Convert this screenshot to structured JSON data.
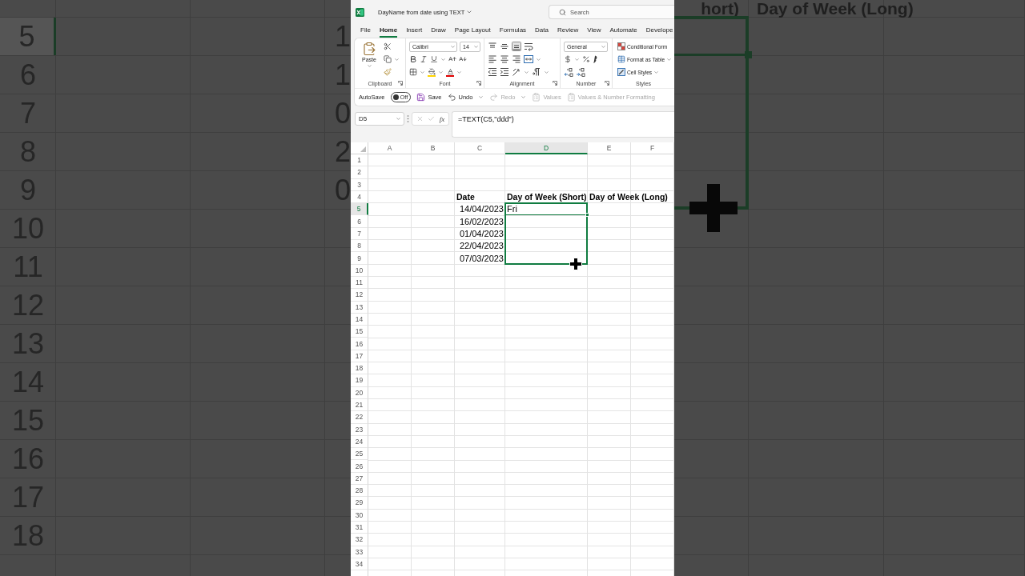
{
  "backdrop_left": {
    "rows": [
      {
        "number": "5",
        "selected": true,
        "column_c": "1"
      },
      {
        "number": "6",
        "selected": false,
        "column_c": "1"
      },
      {
        "number": "7",
        "selected": false,
        "column_c": "0"
      },
      {
        "number": "8",
        "selected": false,
        "column_c": "2"
      },
      {
        "number": "9",
        "selected": false,
        "column_c": "0"
      },
      {
        "number": "10",
        "selected": false
      },
      {
        "number": "11",
        "selected": false
      },
      {
        "number": "12",
        "selected": false
      },
      {
        "number": "13",
        "selected": false
      },
      {
        "number": "14",
        "selected": false
      },
      {
        "number": "15",
        "selected": false
      },
      {
        "number": "16",
        "selected": false
      },
      {
        "number": "17",
        "selected": false
      },
      {
        "number": "18",
        "selected": false
      }
    ]
  },
  "backdrop_right": {
    "headings": [
      "hort)",
      "Day of Week (Long)"
    ],
    "fill_preview": true
  },
  "title_bar": {
    "title": "DayName from date using TEXT",
    "search": {
      "placeholder": "Search"
    }
  },
  "tabs": [
    {
      "label": "File",
      "selected": false
    },
    {
      "label": "Home",
      "selected": true
    },
    {
      "label": "Insert",
      "selected": false
    },
    {
      "label": "Draw",
      "selected": false
    },
    {
      "label": "Page Layout",
      "selected": false
    },
    {
      "label": "Formulas",
      "selected": false
    },
    {
      "label": "Data",
      "selected": false
    },
    {
      "label": "Review",
      "selected": false
    },
    {
      "label": "View",
      "selected": false
    },
    {
      "label": "Automate",
      "selected": false
    },
    {
      "label": "Develope",
      "selected": false
    }
  ],
  "ribbon": {
    "groups": [
      {
        "kind": "clipboard",
        "label": "Clipboard",
        "launcher": true,
        "paste_label": "Paste"
      },
      {
        "kind": "font",
        "label": "Font",
        "launcher": true,
        "font_name": "Calibri",
        "font_size": "14"
      },
      {
        "kind": "alignment",
        "label": "Alignment",
        "launcher": true,
        "vertical_align": [
          {
            "kind": "top",
            "selected": false
          },
          {
            "kind": "middle",
            "selected": false
          },
          {
            "kind": "bottom",
            "selected": true
          }
        ],
        "horizontal_align": [
          {
            "kind": "left",
            "selected": false
          },
          {
            "kind": "center",
            "selected": false
          },
          {
            "kind": "right",
            "selected": false
          }
        ]
      },
      {
        "kind": "number",
        "label": "Number",
        "launcher": true,
        "format": "General"
      },
      {
        "kind": "styles",
        "label": "Styles",
        "launcher": false,
        "items": [
          {
            "kind": "conditional",
            "label": "Conditional Form",
            "dropdown": false
          },
          {
            "kind": "table",
            "label": "Format as Table",
            "dropdown": true
          },
          {
            "kind": "cell_styles",
            "label": "Cell Styles",
            "dropdown": true
          }
        ]
      }
    ]
  },
  "quick_access": {
    "autosave": {
      "label": "AutoSave",
      "on": false,
      "state_label": "Off"
    },
    "buttons": [
      {
        "kind": "save",
        "label": "Save",
        "disabled": false,
        "dropdown": false
      },
      {
        "kind": "undo",
        "label": "Undo",
        "disabled": false,
        "dropdown": true
      },
      {
        "kind": "redo",
        "label": "Redo",
        "disabled": true,
        "dropdown": true
      },
      {
        "kind": "values",
        "label": "Values",
        "disabled": true,
        "dropdown": false
      },
      {
        "kind": "values_formatting",
        "label": "Values & Number Formatting",
        "disabled": true,
        "dropdown": false
      }
    ]
  },
  "formula_bar": {
    "name_box": "D5",
    "insert_function": "fx",
    "formula": "=TEXT(C5,\"ddd\")"
  },
  "sheet": {
    "columns": [
      {
        "label": "A",
        "selected": false
      },
      {
        "label": "B",
        "selected": false
      },
      {
        "label": "C",
        "selected": false
      },
      {
        "label": "D",
        "selected": true
      },
      {
        "label": "E",
        "selected": false
      },
      {
        "label": "F",
        "selected": false
      }
    ],
    "rows": [
      {
        "number": "1",
        "selected": false,
        "fill_preview": false
      },
      {
        "number": "2",
        "selected": false,
        "fill_preview": false
      },
      {
        "number": "3",
        "selected": false,
        "fill_preview": false
      },
      {
        "number": "4",
        "selected": false,
        "fill_preview": false,
        "cells": [
          {},
          {},
          {
            "value": "Date",
            "kind": "text",
            "bold": true
          },
          {
            "value": "Day of Week (Short)",
            "kind": "text",
            "bold": true
          },
          {
            "value": "Day of Week (Long)",
            "kind": "text",
            "bold": true
          },
          {}
        ]
      },
      {
        "number": "5",
        "selected": true,
        "fill_preview": true,
        "cells": [
          {},
          {},
          {
            "value": "14/04/2023",
            "kind": "date",
            "bold": false
          },
          {
            "value": "Fri",
            "kind": "text",
            "bold": false
          },
          {},
          {}
        ]
      },
      {
        "number": "6",
        "selected": false,
        "fill_preview": true,
        "cells": [
          {},
          {},
          {
            "value": "16/02/2023",
            "kind": "date",
            "bold": false
          },
          {},
          {},
          {}
        ]
      },
      {
        "number": "7",
        "selected": false,
        "fill_preview": true,
        "cells": [
          {},
          {},
          {
            "value": "01/04/2023",
            "kind": "date",
            "bold": false
          },
          {},
          {},
          {}
        ]
      },
      {
        "number": "8",
        "selected": false,
        "fill_preview": true,
        "cells": [
          {},
          {},
          {
            "value": "22/04/2023",
            "kind": "date",
            "bold": false
          },
          {},
          {},
          {}
        ]
      },
      {
        "number": "9",
        "selected": false,
        "fill_preview": true,
        "cells": [
          {},
          {},
          {
            "value": "07/03/2023",
            "kind": "date",
            "bold": false
          },
          {},
          {},
          {}
        ]
      },
      {
        "number": "10",
        "selected": false,
        "fill_preview": false
      },
      {
        "number": "11",
        "selected": false,
        "fill_preview": false
      },
      {
        "number": "12",
        "selected": false,
        "fill_preview": false
      },
      {
        "number": "13",
        "selected": false,
        "fill_preview": false
      },
      {
        "number": "14",
        "selected": false,
        "fill_preview": false
      },
      {
        "number": "15",
        "selected": false,
        "fill_preview": false
      },
      {
        "number": "16",
        "selected": false,
        "fill_preview": false
      },
      {
        "number": "17",
        "selected": false,
        "fill_preview": false
      },
      {
        "number": "18",
        "selected": false,
        "fill_preview": false
      },
      {
        "number": "19",
        "selected": false,
        "fill_preview": false
      },
      {
        "number": "20",
        "selected": false,
        "fill_preview": false
      },
      {
        "number": "21",
        "selected": false,
        "fill_preview": false
      },
      {
        "number": "22",
        "selected": false,
        "fill_preview": false
      },
      {
        "number": "23",
        "selected": false,
        "fill_preview": false
      },
      {
        "number": "24",
        "selected": false,
        "fill_preview": false
      },
      {
        "number": "25",
        "selected": false,
        "fill_preview": false
      },
      {
        "number": "26",
        "selected": false,
        "fill_preview": false
      },
      {
        "number": "27",
        "selected": false,
        "fill_preview": false
      },
      {
        "number": "28",
        "selected": false,
        "fill_preview": false
      },
      {
        "number": "29",
        "selected": false,
        "fill_preview": false
      },
      {
        "number": "30",
        "selected": false,
        "fill_preview": false
      },
      {
        "number": "31",
        "selected": false,
        "fill_preview": false
      },
      {
        "number": "32",
        "selected": false,
        "fill_preview": false
      },
      {
        "number": "33",
        "selected": false,
        "fill_preview": false
      },
      {
        "number": "34",
        "selected": false,
        "fill_preview": false
      }
    ]
  }
}
